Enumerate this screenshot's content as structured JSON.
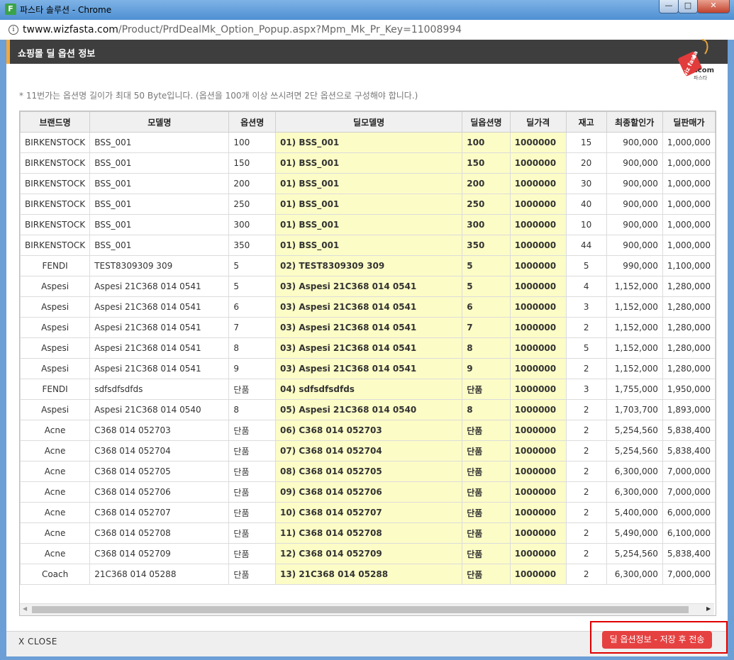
{
  "window": {
    "app_icon": "F",
    "title": "파스타 솔루션 - Chrome",
    "minimize": "—",
    "maximize": "□",
    "close": "✕"
  },
  "address": {
    "domain": "twww.wizfasta.com",
    "path": "/Product/PrdDealMk_Option_Popup.aspx?Mpm_Mk_Pr_Key=11008994"
  },
  "header": {
    "title": "쇼핑몰 딜 옵션 정보"
  },
  "logo": {
    "tag_text": "wiz fasta",
    "domain_text": ".com",
    "sub_text": "파스타"
  },
  "notice": "* 11번가는 옵션명 길이가 최대 50 Byte입니다. (옵션을 100개 이상 쓰시려면 2단 옵션으로 구성해야 합니다.)",
  "columns": [
    "브랜드명",
    "모델명",
    "옵션명",
    "딜모델명",
    "딜옵션명",
    "딜가격",
    "재고",
    "최종할인가",
    "딜판매가"
  ],
  "rows": [
    [
      "BIRKENSTOCK",
      "BSS_001",
      "100",
      "01) BSS_001",
      "100",
      "1000000",
      "15",
      "900,000",
      "1,000,000"
    ],
    [
      "BIRKENSTOCK",
      "BSS_001",
      "150",
      "01) BSS_001",
      "150",
      "1000000",
      "20",
      "900,000",
      "1,000,000"
    ],
    [
      "BIRKENSTOCK",
      "BSS_001",
      "200",
      "01) BSS_001",
      "200",
      "1000000",
      "30",
      "900,000",
      "1,000,000"
    ],
    [
      "BIRKENSTOCK",
      "BSS_001",
      "250",
      "01) BSS_001",
      "250",
      "1000000",
      "40",
      "900,000",
      "1,000,000"
    ],
    [
      "BIRKENSTOCK",
      "BSS_001",
      "300",
      "01) BSS_001",
      "300",
      "1000000",
      "10",
      "900,000",
      "1,000,000"
    ],
    [
      "BIRKENSTOCK",
      "BSS_001",
      "350",
      "01) BSS_001",
      "350",
      "1000000",
      "44",
      "900,000",
      "1,000,000"
    ],
    [
      "FENDI",
      "TEST8309309 309",
      "5",
      "02) TEST8309309 309",
      "5",
      "1000000",
      "5",
      "990,000",
      "1,100,000"
    ],
    [
      "Aspesi",
      "Aspesi 21C368 014 0541",
      "5",
      "03) Aspesi 21C368 014 0541",
      "5",
      "1000000",
      "4",
      "1,152,000",
      "1,280,000"
    ],
    [
      "Aspesi",
      "Aspesi 21C368 014 0541",
      "6",
      "03) Aspesi 21C368 014 0541",
      "6",
      "1000000",
      "3",
      "1,152,000",
      "1,280,000"
    ],
    [
      "Aspesi",
      "Aspesi 21C368 014 0541",
      "7",
      "03) Aspesi 21C368 014 0541",
      "7",
      "1000000",
      "2",
      "1,152,000",
      "1,280,000"
    ],
    [
      "Aspesi",
      "Aspesi 21C368 014 0541",
      "8",
      "03) Aspesi 21C368 014 0541",
      "8",
      "1000000",
      "5",
      "1,152,000",
      "1,280,000"
    ],
    [
      "Aspesi",
      "Aspesi 21C368 014 0541",
      "9",
      "03) Aspesi 21C368 014 0541",
      "9",
      "1000000",
      "2",
      "1,152,000",
      "1,280,000"
    ],
    [
      "FENDI",
      "sdfsdfsdfds",
      "단품",
      "04) sdfsdfsdfds",
      "단품",
      "1000000",
      "3",
      "1,755,000",
      "1,950,000"
    ],
    [
      "Aspesi",
      "Aspesi 21C368 014 0540",
      "8",
      "05) Aspesi 21C368 014 0540",
      "8",
      "1000000",
      "2",
      "1,703,700",
      "1,893,000"
    ],
    [
      "Acne",
      "C368 014 052703",
      "단품",
      "06) C368 014 052703",
      "단품",
      "1000000",
      "2",
      "5,254,560",
      "5,838,400"
    ],
    [
      "Acne",
      "C368 014 052704",
      "단품",
      "07) C368 014 052704",
      "단품",
      "1000000",
      "2",
      "5,254,560",
      "5,838,400"
    ],
    [
      "Acne",
      "C368 014 052705",
      "단품",
      "08) C368 014 052705",
      "단품",
      "1000000",
      "2",
      "6,300,000",
      "7,000,000"
    ],
    [
      "Acne",
      "C368 014 052706",
      "단품",
      "09) C368 014 052706",
      "단품",
      "1000000",
      "2",
      "6,300,000",
      "7,000,000"
    ],
    [
      "Acne",
      "C368 014 052707",
      "단품",
      "10) C368 014 052707",
      "단품",
      "1000000",
      "2",
      "5,400,000",
      "6,000,000"
    ],
    [
      "Acne",
      "C368 014 052708",
      "단품",
      "11) C368 014 052708",
      "단품",
      "1000000",
      "2",
      "5,490,000",
      "6,100,000"
    ],
    [
      "Acne",
      "C368 014 052709",
      "단품",
      "12) C368 014 052709",
      "단품",
      "1000000",
      "2",
      "5,254,560",
      "5,838,400"
    ],
    [
      "Coach",
      "21C368 014 05288",
      "단품",
      "13) 21C368 014 05288",
      "단품",
      "1000000",
      "2",
      "6,300,000",
      "7,000,000"
    ]
  ],
  "scrollbar": {
    "left_arrow": "◀",
    "right_arrow": "▶"
  },
  "footer": {
    "close_label": "X CLOSE",
    "save_label": "딜 옵션정보 - 저장 후 전송"
  },
  "colors": {
    "header_bg": "#3e3e3e",
    "header_accent": "#f2a93b",
    "deal_cell_bg": "#fcfcc6",
    "save_button": "#e64141",
    "highlight_border": "#e00000"
  }
}
